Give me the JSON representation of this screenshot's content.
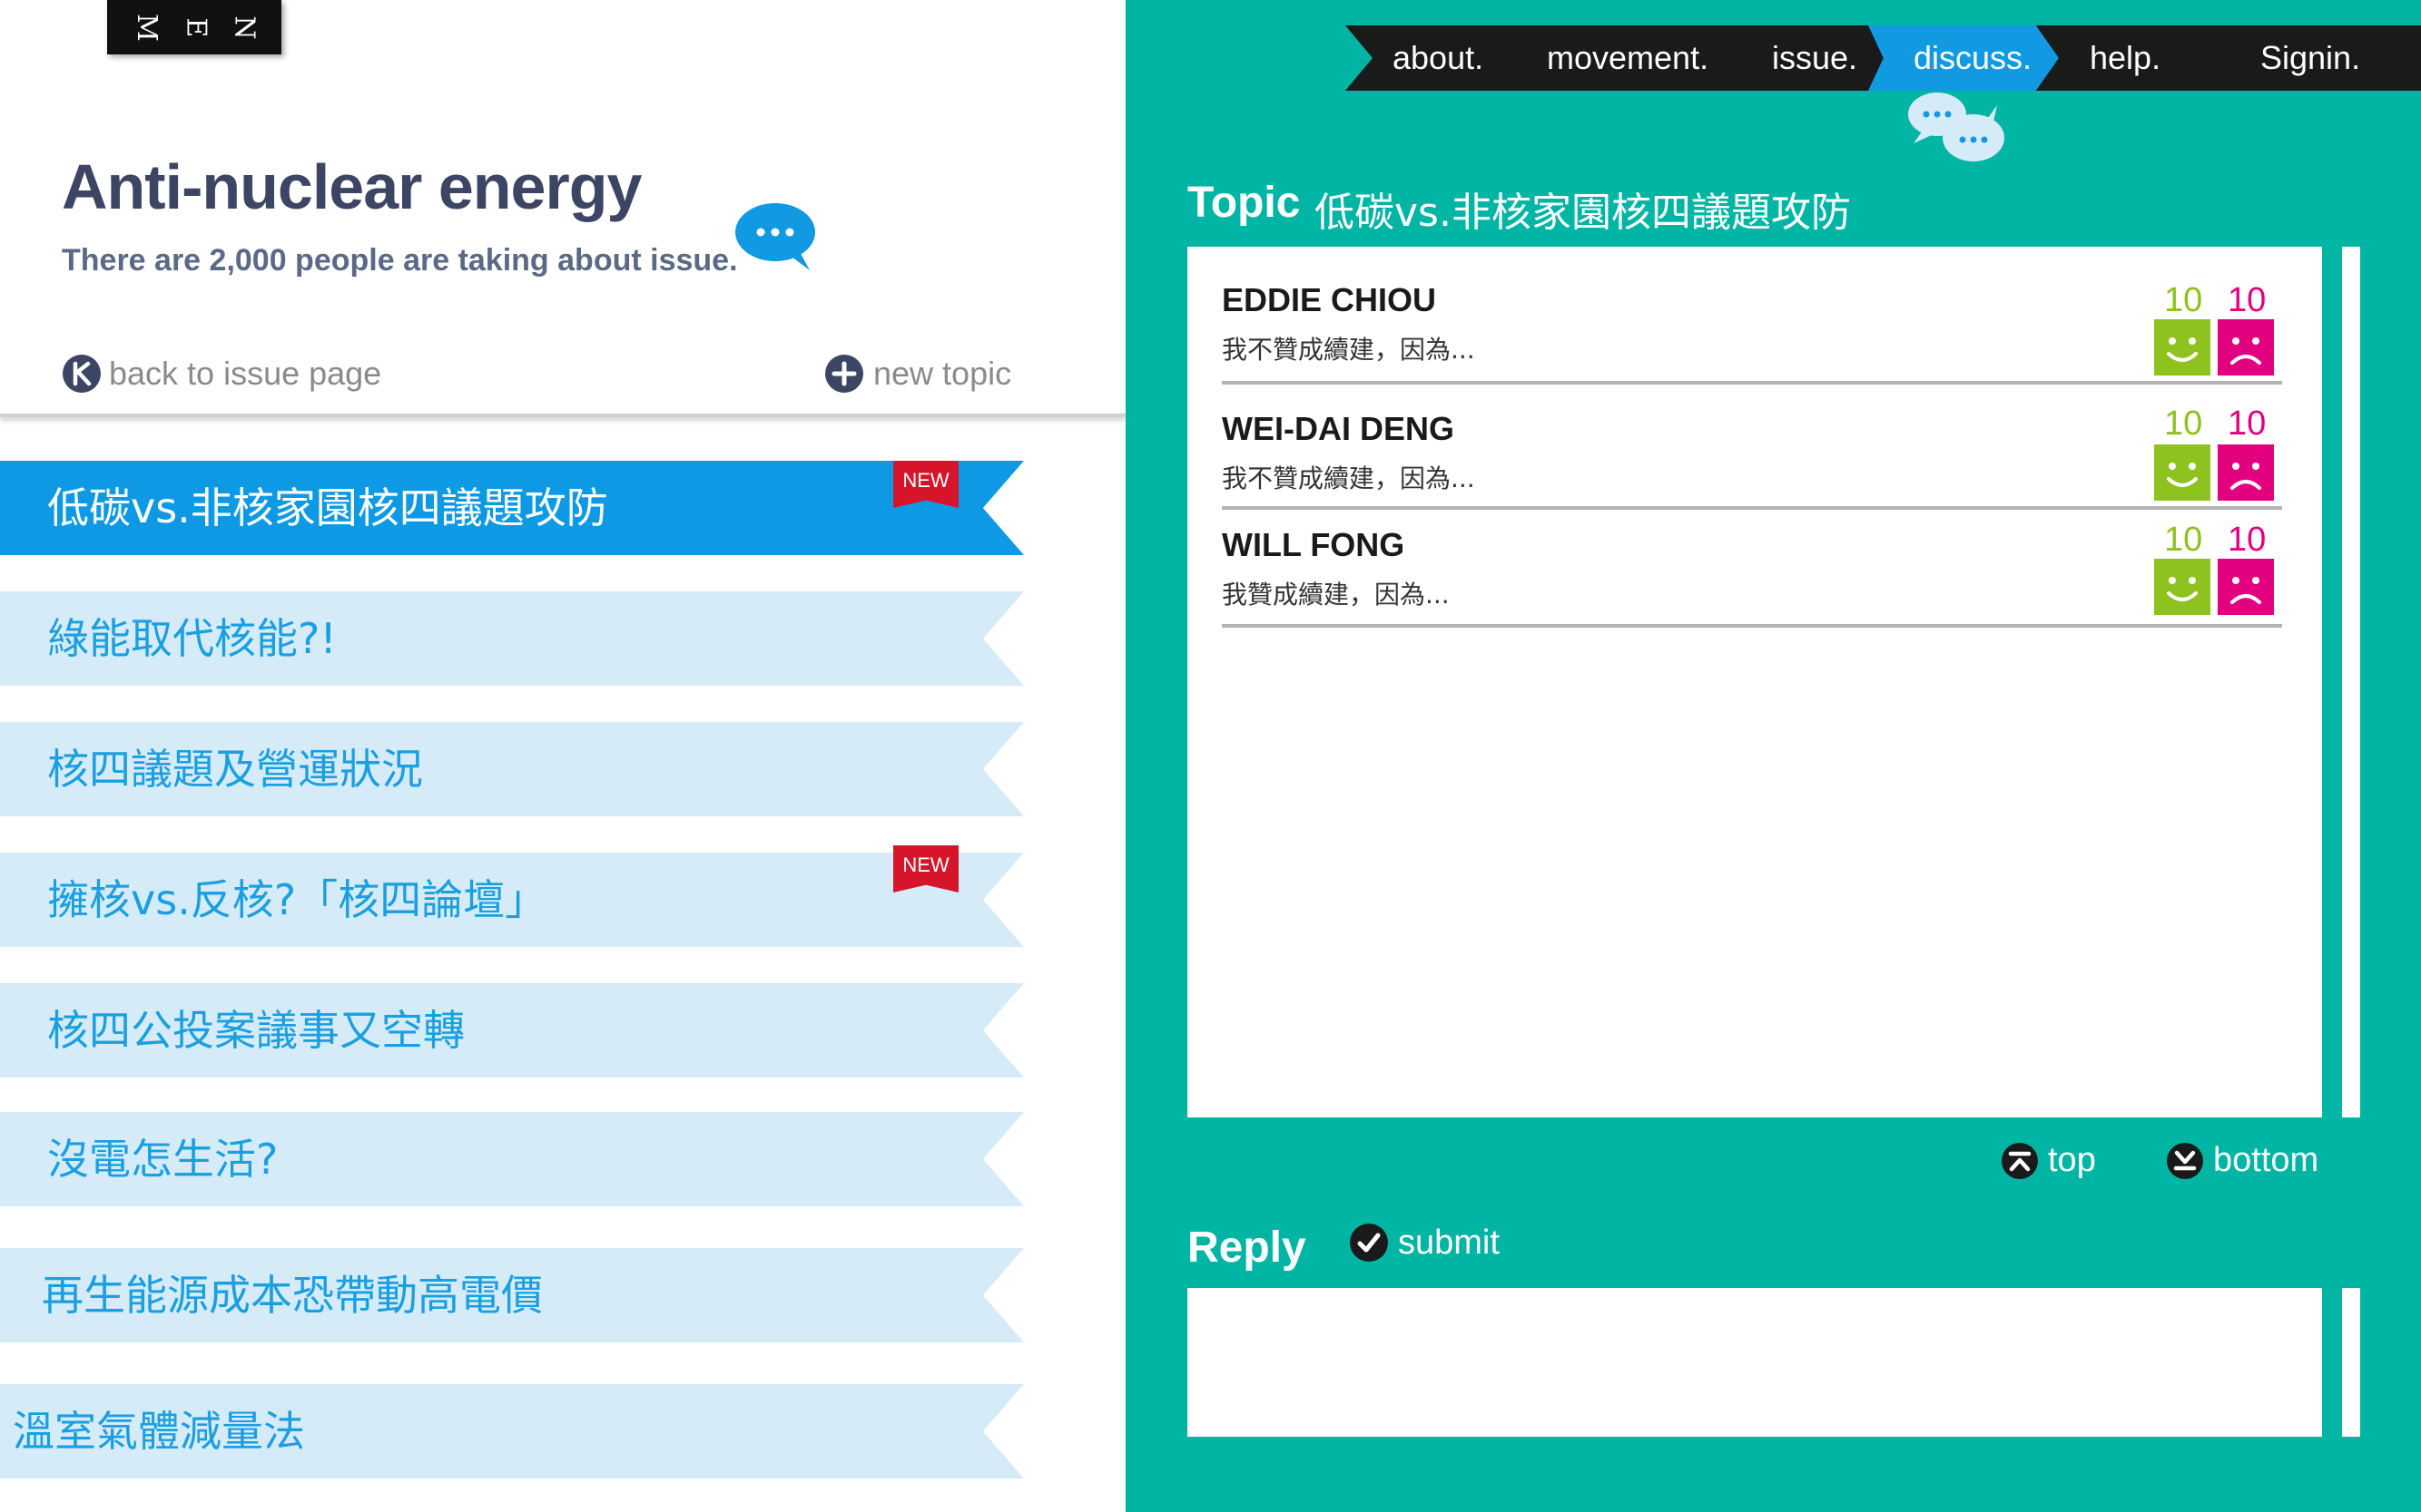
{
  "menu": {
    "letters": [
      "M",
      "E",
      "N"
    ]
  },
  "issue": {
    "title": "Anti-nuclear energy",
    "subtitle": "There are 2,000 people are taking about issue."
  },
  "actions": {
    "back_label": "back to issue page",
    "new_topic_label": "new topic"
  },
  "topics": [
    {
      "label": "低碳vs.非核家園核四議題攻防",
      "active": true,
      "badge": "NEW"
    },
    {
      "label": "綠能取代核能?!",
      "active": false
    },
    {
      "label": "核四議題及營運狀況",
      "active": false
    },
    {
      "label": "擁核vs.反核?「核四論壇」",
      "active": false,
      "badge": "NEW"
    },
    {
      "label": "核四公投案議事又空轉",
      "active": false
    },
    {
      "label": "沒電怎生活?",
      "active": false
    },
    {
      "label": "再生能源成本恐帶動高電價",
      "active": false
    },
    {
      "label": "溫室氣體減量法",
      "active": false
    }
  ],
  "nav": {
    "items": [
      "about.",
      "movement.",
      "issue.",
      "discuss.",
      "help.",
      "Signin."
    ],
    "active": "discuss."
  },
  "discussion": {
    "topic_label": "Topic",
    "topic_title": "低碳vs.非核家園核四議題攻防",
    "comments": [
      {
        "author": "EDDIE CHIOU",
        "text": "我不贊成續建，因為...",
        "likes": "10",
        "dislikes": "10"
      },
      {
        "author": "WEI-DAI DENG",
        "text": "我不贊成續建，因為...",
        "likes": "10",
        "dislikes": "10"
      },
      {
        "author": "WILL FONG",
        "text": "我贊成續建，因為...",
        "likes": "10",
        "dislikes": "10"
      }
    ],
    "top_label": "top",
    "bottom_label": "bottom"
  },
  "reply": {
    "label": "Reply",
    "submit_label": "submit",
    "value": ""
  },
  "colors": {
    "accent_teal": "#00b5a4",
    "accent_blue": "#0d99e4",
    "ribbon_light": "#d5ebf8",
    "like_green": "#8dc21f",
    "dislike_pink": "#e3007f",
    "badge_red": "#d7152a",
    "title_navy": "#3c4564"
  },
  "icons": {
    "menu": "menu-icon",
    "back": "back-circle-icon",
    "new_topic": "plus-circle-icon",
    "speech": "speech-bubble-icon",
    "chat": "chat-bubbles-icon",
    "like": "smile-face-icon",
    "dislike": "sad-face-icon",
    "top": "arrow-up-circle-icon",
    "bottom": "arrow-down-circle-icon",
    "submit": "check-circle-icon"
  }
}
